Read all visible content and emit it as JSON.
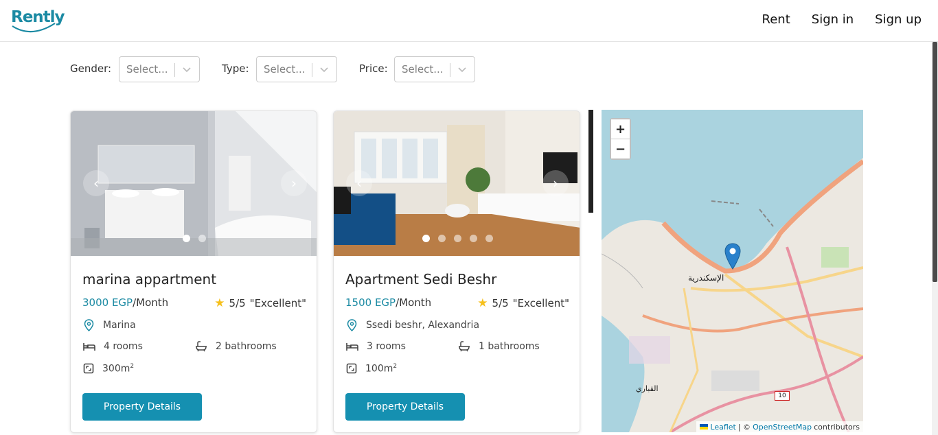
{
  "brand": {
    "logo_text": "Rently"
  },
  "nav": {
    "rent": "Rent",
    "sign_in": "Sign in",
    "sign_up": "Sign up"
  },
  "filters": [
    {
      "label": "Gender:",
      "placeholder": "Select..."
    },
    {
      "label": "Type:",
      "placeholder": "Select..."
    },
    {
      "label": "Price:",
      "placeholder": "Select..."
    }
  ],
  "colors": {
    "accent": "#1b8aa3",
    "button": "#1590b1",
    "star": "#f6c01b"
  },
  "listings": [
    {
      "title": "marina appartment",
      "price": "3000 EGP",
      "period": "/Month",
      "rating": "5/5",
      "rating_label": "\"Excellent\"",
      "location": "Marina",
      "rooms": "4 rooms",
      "bathrooms": "2 bathrooms",
      "area": "300m",
      "area_unit": "2",
      "image_count": 2,
      "active_image": 1,
      "button": "Property Details"
    },
    {
      "title": "Apartment Sedi Beshr",
      "price": "1500 EGP",
      "period": "/Month",
      "rating": "5/5",
      "rating_label": "\"Excellent\"",
      "location": "Ssedi beshr, Alexandria",
      "rooms": "3 rooms",
      "bathrooms": "1 bathrooms",
      "area": "100m",
      "area_unit": "2",
      "image_count": 5,
      "active_image": 1,
      "button": "Property Details"
    }
  ],
  "map": {
    "zoom_in": "+",
    "zoom_out": "−",
    "city_label": "الإسكندرية",
    "district_label": "القباري",
    "road_number": "10",
    "attribution": {
      "leaflet": "Leaflet",
      "separator": "| ©",
      "osm": "OpenStreetMap",
      "contributors": "contributors"
    }
  }
}
